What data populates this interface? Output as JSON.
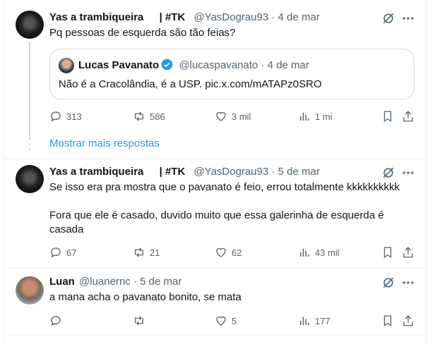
{
  "tweets": [
    {
      "name": "Yas a trambiqueira",
      "tag": "| #TK",
      "handle": "@YasDograu93",
      "date": "4 de mar",
      "text": "Pq pessoas de esquerda são tão feias?",
      "quote": {
        "name": "Lucas Pavanato",
        "handle": "@lucaspavanato",
        "date": "4 de mar",
        "text": "Não é a Cracolândia, é a USP. pic.x.com/mATAPz0SRO"
      },
      "replies": "313",
      "retweets": "586",
      "likes": "3 mil",
      "views": "1 mi"
    },
    {
      "name": "Yas a trambiqueira",
      "tag": "| #TK",
      "handle": "@YasDograu93",
      "date": "5 de mar",
      "text1": "Se isso era pra mostra que o pavanato é feio, errou totalmente kkkkkkkkkk",
      "text2": "Fora que ele é casado, duvido muito que essa galerinha de esquerda é",
      "text3": "casada",
      "replies": "67",
      "retweets": "21",
      "likes": "62",
      "views": "43 mil"
    },
    {
      "name": "Luan",
      "handle": "@luanernc",
      "date": "5 de mar",
      "text": "a mana acha o pavanato bonito, se mata",
      "replies": "",
      "retweets": "",
      "likes": "5",
      "views": "177"
    }
  ],
  "show_more": "Mostrar mais respostas",
  "separator": "·",
  "colors": {
    "link": "#1d9bf0",
    "muted": "#536471",
    "verified": "#1d9bf0"
  }
}
